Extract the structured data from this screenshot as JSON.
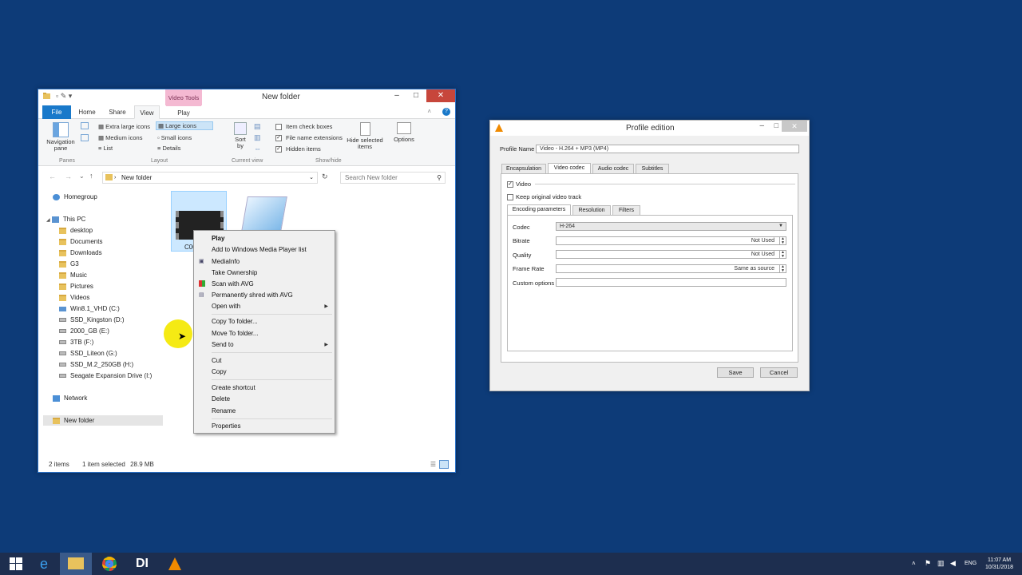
{
  "explorer": {
    "title": "New folder",
    "contextual_tab": "Video Tools",
    "tabs": [
      "File",
      "Home",
      "Share",
      "View",
      "Play"
    ],
    "ribbon": {
      "navigation_pane": "Navigation pane",
      "layout_items": [
        "Extra large icons",
        "Large icons",
        "Medium icons",
        "Small icons",
        "List",
        "Details"
      ],
      "sort_by": "Sort by",
      "checkboxes": [
        {
          "label": "Item check boxes",
          "checked": false
        },
        {
          "label": "File name extensions",
          "checked": true
        },
        {
          "label": "Hidden items",
          "checked": true
        }
      ],
      "hide_selected": "Hide selected items",
      "options": "Options",
      "groups": [
        "Panes",
        "Layout",
        "Current view",
        "Show/hide"
      ]
    },
    "address": "New folder",
    "search_placeholder": "Search New folder",
    "nav": [
      {
        "label": "Homegroup",
        "icon": "homegroup-icon"
      },
      {
        "label": "This PC",
        "icon": "computer-icon"
      },
      {
        "label": "desktop",
        "icon": "folder-icon"
      },
      {
        "label": "Documents",
        "icon": "folder-icon"
      },
      {
        "label": "Downloads",
        "icon": "folder-icon"
      },
      {
        "label": "G3",
        "icon": "folder-icon"
      },
      {
        "label": "Music",
        "icon": "folder-icon"
      },
      {
        "label": "Pictures",
        "icon": "folder-icon"
      },
      {
        "label": "Videos",
        "icon": "folder-icon"
      },
      {
        "label": "Win8.1_VHD (C:)",
        "icon": "drive-icon"
      },
      {
        "label": "SSD_Kingston (D:)",
        "icon": "drive-icon"
      },
      {
        "label": "2000_GB (E:)",
        "icon": "drive-icon"
      },
      {
        "label": "3TB (F:)",
        "icon": "drive-icon"
      },
      {
        "label": "SSD_Liteon (G:)",
        "icon": "drive-icon"
      },
      {
        "label": "SSD_M.2_250GB (H:)",
        "icon": "drive-icon"
      },
      {
        "label": "Seagate Expansion Drive (I:)",
        "icon": "drive-icon"
      },
      {
        "label": "Network",
        "icon": "network-icon"
      },
      {
        "label": "New folder",
        "icon": "folder-icon"
      }
    ],
    "files": [
      {
        "name": "C00"
      }
    ],
    "status": {
      "count": "2 items",
      "selected": "1 item selected",
      "size": "28.9 MB"
    }
  },
  "context_menu": {
    "items": [
      {
        "label": "Play",
        "bold": true
      },
      {
        "label": "Add to Windows Media Player list"
      },
      {
        "label": "MediaInfo"
      },
      {
        "label": "Take Ownership"
      },
      {
        "label": "Scan with AVG"
      },
      {
        "label": "Permanently shred with AVG"
      },
      {
        "label": "Open with",
        "submenu": true
      },
      {
        "label": "Copy To folder..."
      },
      {
        "label": "Move To folder..."
      },
      {
        "label": "Send to",
        "submenu": true
      },
      {
        "label": "Cut"
      },
      {
        "label": "Copy"
      },
      {
        "label": "Create shortcut"
      },
      {
        "label": "Delete"
      },
      {
        "label": "Rename"
      },
      {
        "label": "Properties"
      }
    ]
  },
  "vlc": {
    "title": "Profile edition",
    "profile_name_label": "Profile Name",
    "profile_name": "Video - H.264 + MP3 (MP4)",
    "tabs": [
      "Encapsulation",
      "Video codec",
      "Audio codec",
      "Subtitles"
    ],
    "video_checkbox": "Video",
    "keep_original": "Keep original video track",
    "subtabs": [
      "Encoding parameters",
      "Resolution",
      "Filters"
    ],
    "fields": {
      "codec_label": "Codec",
      "codec": "H-264",
      "bitrate_label": "Bitrate",
      "bitrate": "Not Used",
      "quality_label": "Quality",
      "quality": "Not Used",
      "framerate_label": "Frame Rate",
      "framerate": "Same as source",
      "custom_label": "Custom options",
      "custom": ""
    },
    "save": "Save",
    "cancel": "Cancel"
  },
  "taskbar": {
    "lang": "ENG",
    "time": "11:07 AM",
    "date": "10/31/2018"
  }
}
